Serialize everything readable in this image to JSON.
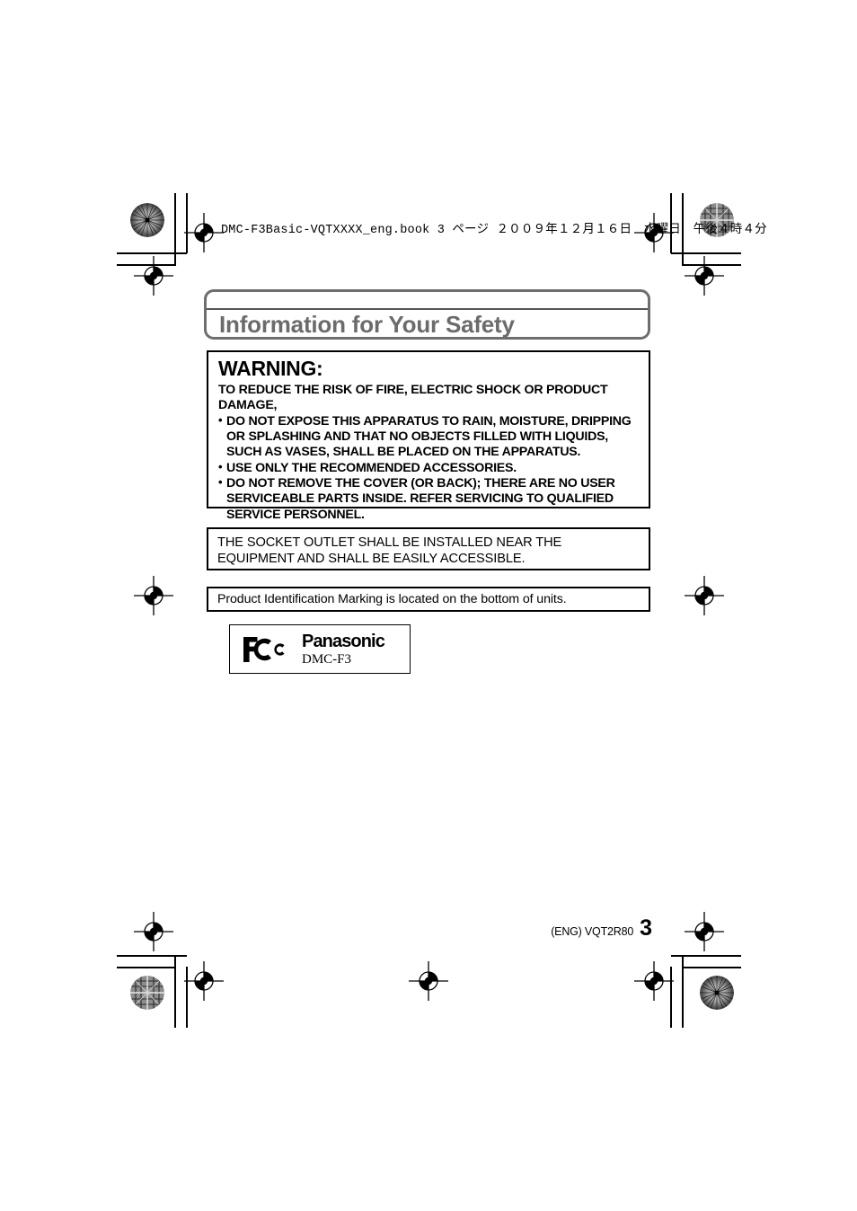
{
  "page": {
    "book_header": "DMC-F3Basic-VQTXXXX_eng.book  3 ページ  ２００９年１２月１６日　水曜日　午後４時４分",
    "title": "Information for Your Safety"
  },
  "warning": {
    "heading": "WARNING:",
    "lead": "TO REDUCE THE RISK OF FIRE, ELECTRIC SHOCK OR PRODUCT DAMAGE,",
    "bullet_char": "•",
    "items": [
      "DO NOT EXPOSE THIS APPARATUS TO RAIN, MOISTURE, DRIPPING OR SPLASHING AND THAT NO OBJECTS FILLED WITH LIQUIDS, SUCH AS VASES, SHALL BE PLACED ON THE APPARATUS.",
      "USE ONLY THE RECOMMENDED ACCESSORIES.",
      "DO NOT REMOVE THE COVER (OR BACK); THERE ARE NO USER SERVICEABLE PARTS INSIDE. REFER SERVICING TO QUALIFIED SERVICE PERSONNEL."
    ]
  },
  "socket_notice": {
    "text": "THE SOCKET OUTLET SHALL BE INSTALLED NEAR THE EQUIPMENT AND SHALL BE EASILY ACCESSIBLE."
  },
  "product_id_notice": {
    "text": "Product Identification Marking is located on the bottom of units."
  },
  "logo_box": {
    "fcc_label": "FC",
    "brand": "Panasonic",
    "model": "DMC-F3"
  },
  "footer": {
    "code": "(ENG) VQT2R80",
    "page_number": "3"
  },
  "colors": {
    "banner_border": "#6e6e6e",
    "banner_text": "#6b6b6b",
    "box_border": "#000000",
    "text": "#000000",
    "background": "#ffffff"
  }
}
